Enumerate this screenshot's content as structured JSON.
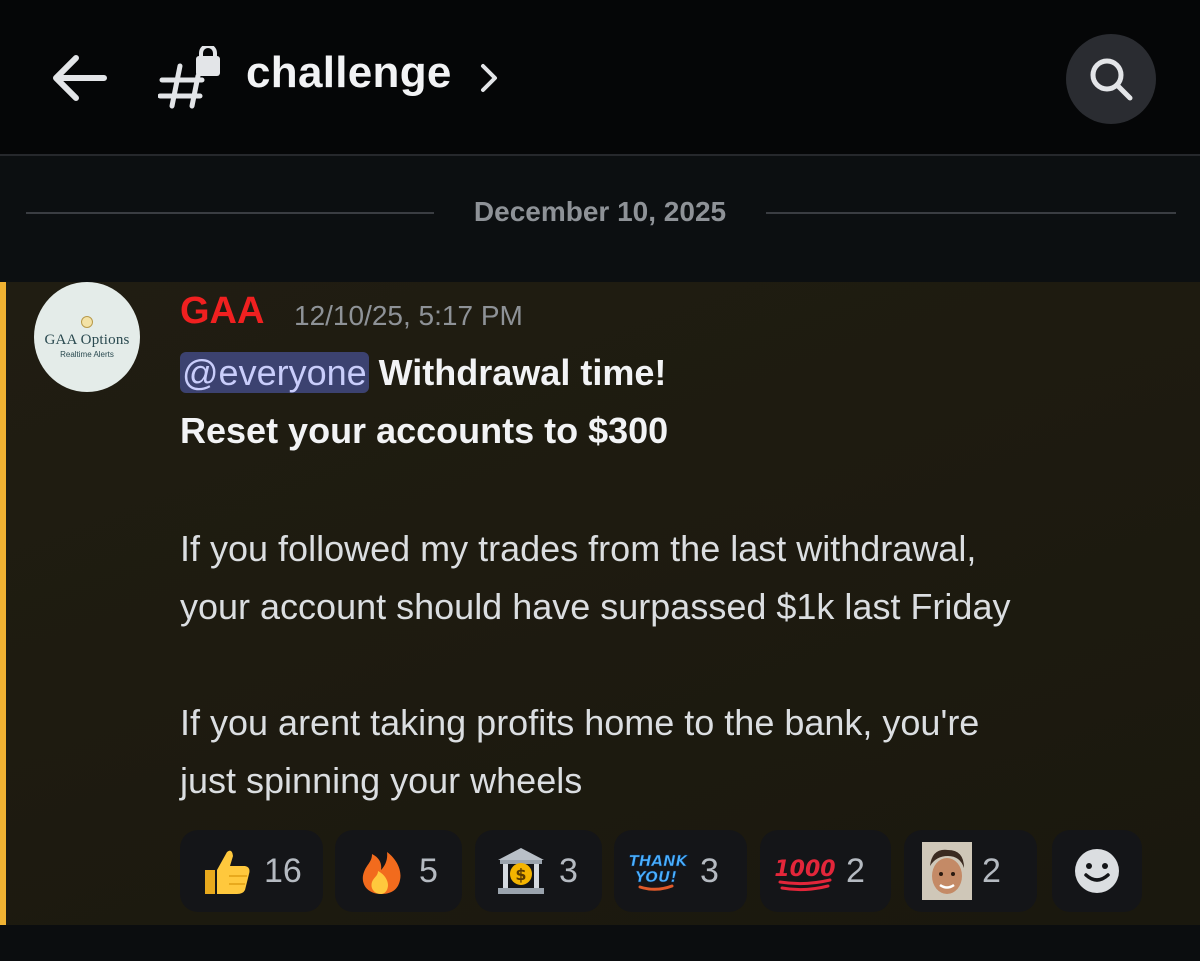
{
  "header": {
    "channel_name": "challenge"
  },
  "date_separator": "December 10, 2025",
  "message": {
    "avatar_title": "GAA Options",
    "avatar_subtitle": "Realtime Alerts",
    "author": "GAA",
    "timestamp": "12/10/25, 5:17 PM",
    "mention": "@everyone",
    "line1_rest": " Withdrawal time!",
    "line2": "Reset your accounts to $300",
    "para1_line1": "If you followed my trades from the last withdrawal,",
    "para1_line2": "your account should have surpassed $1k last Friday",
    "para2_line1": "If you arent taking profits home to the bank, you're",
    "para2_line2": "just spinning your wheels"
  },
  "reactions": [
    {
      "icon": "thumbs-up-icon",
      "count": "16"
    },
    {
      "icon": "fire-icon",
      "count": "5"
    },
    {
      "icon": "bank-icon",
      "count": "3"
    },
    {
      "icon": "thank-you-icon",
      "count": "3",
      "label": "THANK YOU!"
    },
    {
      "icon": "hundred-icon",
      "count": "2",
      "label": "1000"
    },
    {
      "icon": "face-avatar-icon",
      "count": "2"
    }
  ],
  "colors": {
    "author": "#f02020",
    "highlight": "#f0b232",
    "mention_bg": "#3c4270"
  }
}
